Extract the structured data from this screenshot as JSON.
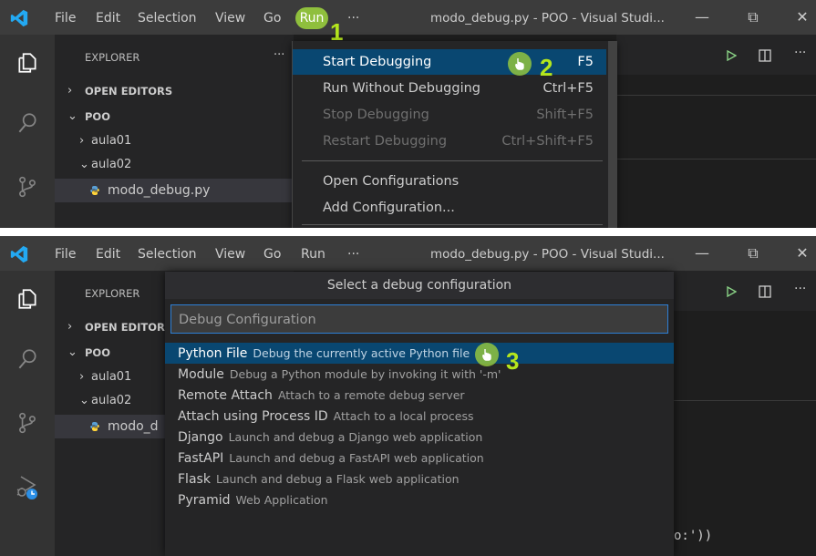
{
  "window": {
    "title": "modo_debug.py - POO - Visual Studi...",
    "menus": [
      "File",
      "Edit",
      "Selection",
      "View",
      "Go",
      "Run",
      "···"
    ],
    "controls": {
      "minimize": "—",
      "restore": "⧉",
      "close": "✕"
    }
  },
  "sidebar": {
    "header": "EXPLORER",
    "more": "···",
    "open_editors": "OPEN EDITORS",
    "open_editors_short": "OPEN EDITOR",
    "folder": "POO",
    "items": [
      "aula01",
      "aula02"
    ],
    "file": "modo_debug.py",
    "file_short": "modo_d"
  },
  "run_menu": {
    "items": [
      {
        "label": "Start Debugging",
        "shortcut": "F5"
      },
      {
        "label": "Run Without Debugging",
        "shortcut": "Ctrl+F5"
      },
      {
        "label": "Stop Debugging",
        "shortcut": "Shift+F5"
      },
      {
        "label": "Restart Debugging",
        "shortcut": "Ctrl+Shift+F5"
      },
      {
        "label": "Open Configurations",
        "shortcut": ""
      },
      {
        "label": "Add Configuration...",
        "shortcut": ""
      }
    ]
  },
  "quick_pick": {
    "title": "Select a debug configuration",
    "placeholder": "Debug Configuration",
    "options": [
      {
        "label": "Python File",
        "desc": "Debug the currently active Python file"
      },
      {
        "label": "Module",
        "desc": "Debug a Python module by invoking it with '-m'"
      },
      {
        "label": "Remote Attach",
        "desc": "Attach to a remote debug server"
      },
      {
        "label": "Attach using Process ID",
        "desc": "Attach to a local process"
      },
      {
        "label": "Django",
        "desc": "Launch and debug a Django web application"
      },
      {
        "label": "FastAPI",
        "desc": "Launch and debug a FastAPI web application"
      },
      {
        "label": "Flask",
        "desc": "Launch and debug a Flask web application"
      },
      {
        "label": "Pyramid",
        "desc": "Web Application"
      }
    ]
  },
  "code_tail": "o:'))",
  "steps": [
    "1",
    "2",
    "3"
  ],
  "colors": {
    "accent": "#8fbf3d",
    "selection": "#094771",
    "step": "#b5e61d",
    "input_border": "#2e7fd6"
  }
}
